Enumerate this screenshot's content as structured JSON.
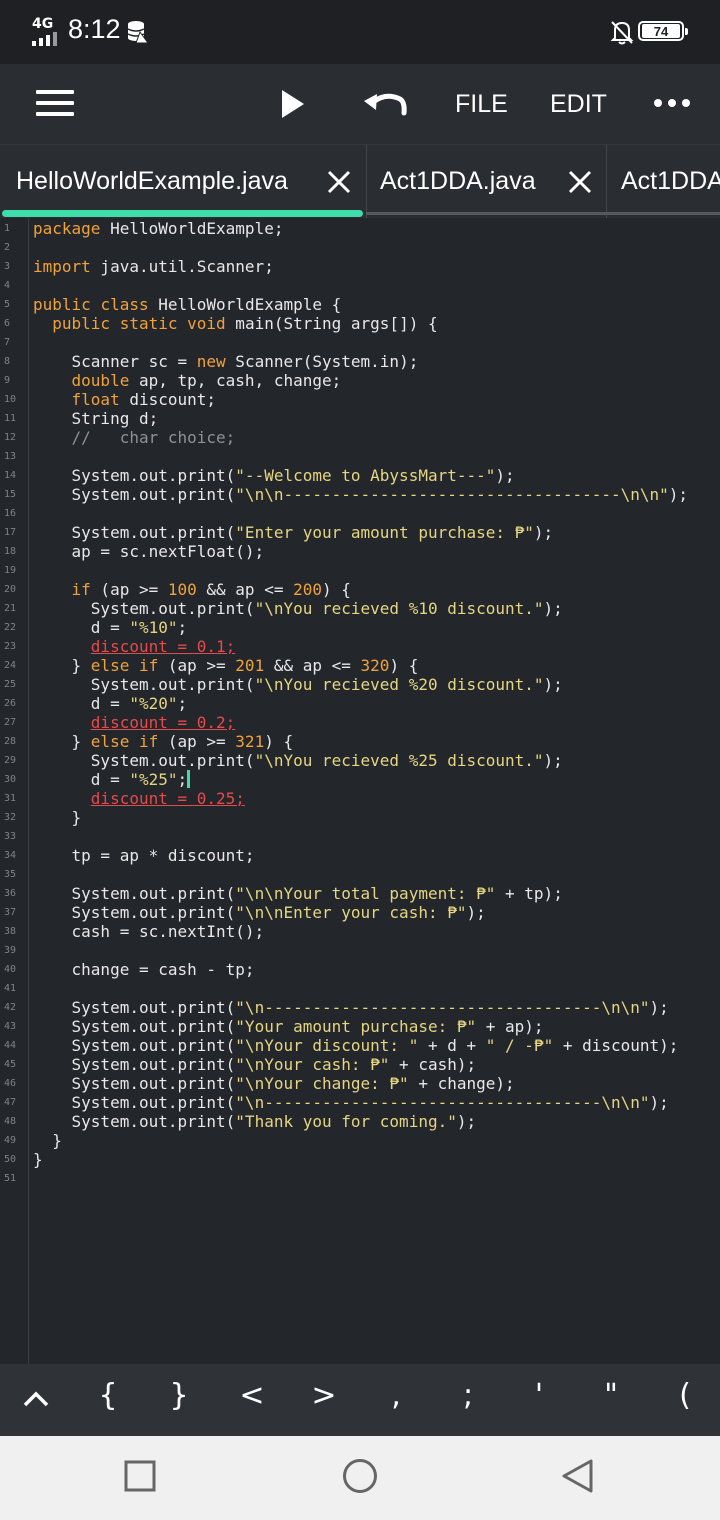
{
  "status": {
    "network": "4G",
    "time": "8:12",
    "battery": "74"
  },
  "toolbar": {
    "file": "FILE",
    "edit": "EDIT"
  },
  "tabs": [
    {
      "name": "HelloWorldExample.java"
    },
    {
      "name": "Act1DDA.java"
    },
    {
      "name": "Act1DDA"
    }
  ],
  "editor": {
    "line_numbers": [
      "1",
      "2",
      "3",
      "4",
      "5",
      "6",
      "7",
      "8",
      "9",
      "10",
      "11",
      "12",
      "13",
      "14",
      "15",
      "16",
      "17",
      "18",
      "19",
      "20",
      "21",
      "22",
      "23",
      "24",
      "25",
      "26",
      "27",
      "28",
      "29",
      "30",
      "31",
      "32",
      "33",
      "34",
      "35",
      "36",
      "37",
      "38",
      "39",
      "40",
      "41",
      "42",
      "43",
      "44",
      "45",
      "46",
      "47",
      "48",
      "49",
      "50",
      "51"
    ],
    "lines": [
      "package HelloWorldExample;",
      "",
      "import java.util.Scanner;",
      "",
      "public class HelloWorldExample {",
      "  public static void main(String args[]) {",
      "",
      "    Scanner sc = new Scanner(System.in);",
      "    double ap, tp, cash, change;",
      "    float discount;",
      "    String d;",
      "    //   char choice;",
      "",
      "    System.out.print(\"--Welcome to AbyssMart---\");",
      "    System.out.print(\"\\n\\n-----------------------------------\\n\\n\");",
      "",
      "    System.out.print(\"Enter your amount purchase: ₱\");",
      "    ap = sc.nextFloat();",
      "",
      "    if (ap >= 100 && ap <= 200) {",
      "      System.out.print(\"\\nYou recieved %10 discount.\");",
      "      d = \"%10\";",
      "      discount = 0.1;",
      "    } else if (ap >= 201 && ap <= 320) {",
      "      System.out.print(\"\\nYou recieved %20 discount.\");",
      "      d = \"%20\";",
      "      discount = 0.2;",
      "    } else if (ap >= 321) {",
      "      System.out.print(\"\\nYou recieved %25 discount.\");",
      "      d = \"%25\";",
      "      discount = 0.25;",
      "    }",
      "",
      "    tp = ap * discount;",
      "",
      "    System.out.print(\"\\n\\nYour total payment: ₱\" + tp);",
      "    System.out.print(\"\\n\\nEnter your cash: ₱\");",
      "    cash = sc.nextInt();",
      "",
      "    change = cash - tp;",
      "",
      "    System.out.print(\"\\n-----------------------------------\\n\\n\");",
      "    System.out.print(\"Your amount purchase: ₱\" + ap);",
      "    System.out.print(\"\\nYour discount: \" + d + \" / -₱\" + discount);",
      "    System.out.print(\"\\nYour cash: ₱\" + cash);",
      "    System.out.print(\"\\nYour change: ₱\" + change);",
      "    System.out.print(\"\\n-----------------------------------\\n\\n\");",
      "    System.out.print(\"Thank you for coming.\");",
      "  }",
      "}",
      ""
    ]
  },
  "keys": [
    "{",
    "}",
    "<",
    ">",
    ",",
    ";",
    "'",
    "\"",
    "("
  ],
  "colors": {
    "accent": "#3ddca9",
    "keyword": "#f0a23b",
    "string": "#e6d581",
    "error": "#e54b4b",
    "background": "#23262b"
  },
  "icons": [
    "menu-icon",
    "play-icon",
    "undo-icon",
    "more-icon",
    "close-icon",
    "caret-up-icon",
    "square-nav-icon",
    "circle-nav-icon",
    "back-nav-icon"
  ]
}
